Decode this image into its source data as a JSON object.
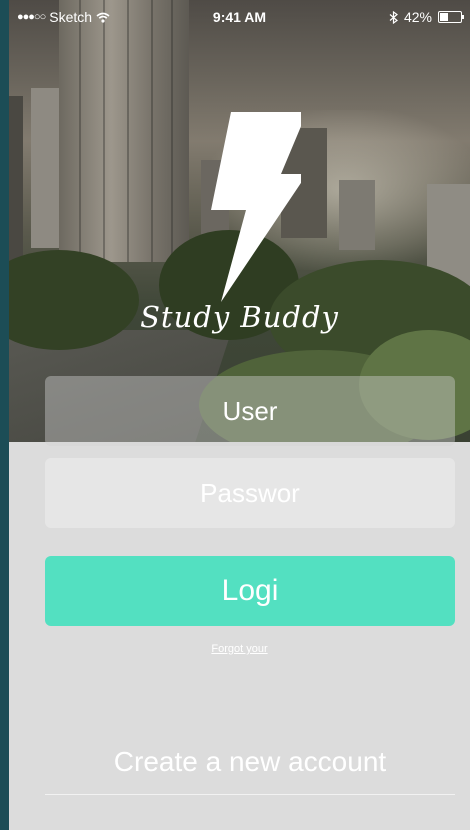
{
  "status_bar": {
    "carrier": "Sketch",
    "time": "9:41 AM",
    "battery_percent": "42%",
    "battery_level": 0.42,
    "icons": [
      "signal-dots-icon",
      "wifi-icon",
      "bluetooth-icon",
      "battery-icon"
    ]
  },
  "branding": {
    "logo_icon": "lightning-bolt-icon",
    "app_name": "Study Buddy"
  },
  "form": {
    "user_placeholder": "User",
    "password_placeholder": "Passwor",
    "login_label": "Logi",
    "forgot_label": "Forgot your"
  },
  "footer": {
    "create_account_label": "Create a new account"
  },
  "colors": {
    "accent": "#53e0c1",
    "panel": "#dcdcdc",
    "frame": "#1c4d56"
  }
}
